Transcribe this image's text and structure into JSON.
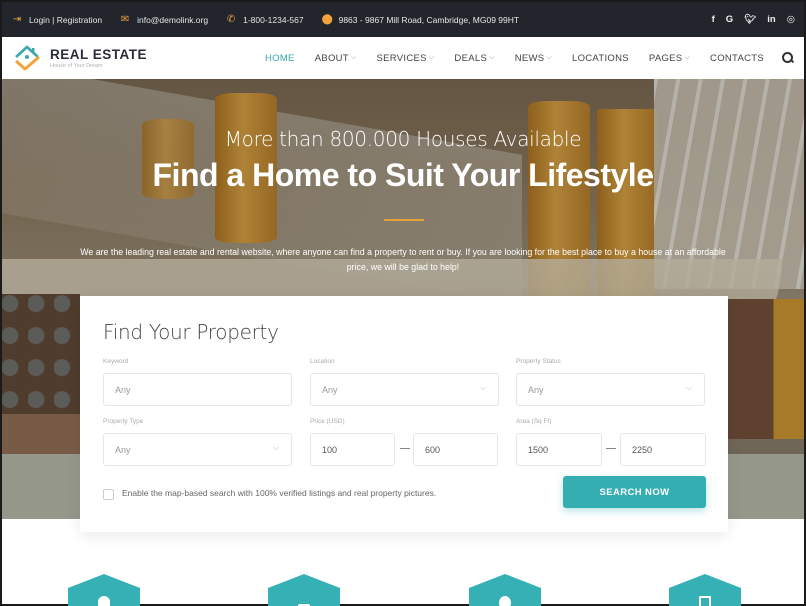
{
  "topbar": {
    "login": "Login | Registration",
    "email": "info@demolink.org",
    "phone": "1-800-1234-567",
    "address": "9863 - 9867 Mill Road, Cambridge, MG09 99HT",
    "social": [
      "f",
      "G",
      "t",
      "in",
      "ig"
    ]
  },
  "header": {
    "brand": "REAL ESTATE",
    "tagline": "House of Your Dream",
    "nav": [
      {
        "label": "HOME",
        "active": true,
        "dropdown": false
      },
      {
        "label": "ABOUT",
        "active": false,
        "dropdown": true
      },
      {
        "label": "SERVICES",
        "active": false,
        "dropdown": true
      },
      {
        "label": "DEALS",
        "active": false,
        "dropdown": true
      },
      {
        "label": "NEWS",
        "active": false,
        "dropdown": true
      },
      {
        "label": "LOCATIONS",
        "active": false,
        "dropdown": false
      },
      {
        "label": "PAGES",
        "active": false,
        "dropdown": true
      },
      {
        "label": "CONTACTS",
        "active": false,
        "dropdown": false
      }
    ]
  },
  "hero": {
    "subtitle": "More than 800.000 Houses Available",
    "title": "Find a Home to Suit Your Lifestyle",
    "description": "We are the leading real estate and rental website, where anyone can find a property to rent or buy. If you are looking for the best place to buy a house at an affordable price, we will be glad to help!"
  },
  "search": {
    "title": "Find Your Property",
    "keyword": {
      "label": "Keyword",
      "placeholder": "Any"
    },
    "location": {
      "label": "Location",
      "value": "Any"
    },
    "status": {
      "label": "Property Status",
      "value": "Any"
    },
    "type": {
      "label": "Property Type",
      "value": "Any"
    },
    "price": {
      "label": "Price (USD)",
      "min": "100",
      "max": "600"
    },
    "area": {
      "label": "Area (Sq Ft)",
      "min": "1500",
      "max": "2250"
    },
    "map_checkbox": {
      "label": "Enable the map-based search with 100% verified listings and real property pictures.",
      "checked": false
    },
    "button": "SEARCH NOW"
  },
  "features": {
    "icons": [
      "person-icon",
      "heart-icon",
      "globe-icon",
      "document-icon"
    ]
  },
  "colors": {
    "accent": "#35aeb2",
    "orange": "#f2a33a",
    "topbar_bg": "#23252d"
  }
}
